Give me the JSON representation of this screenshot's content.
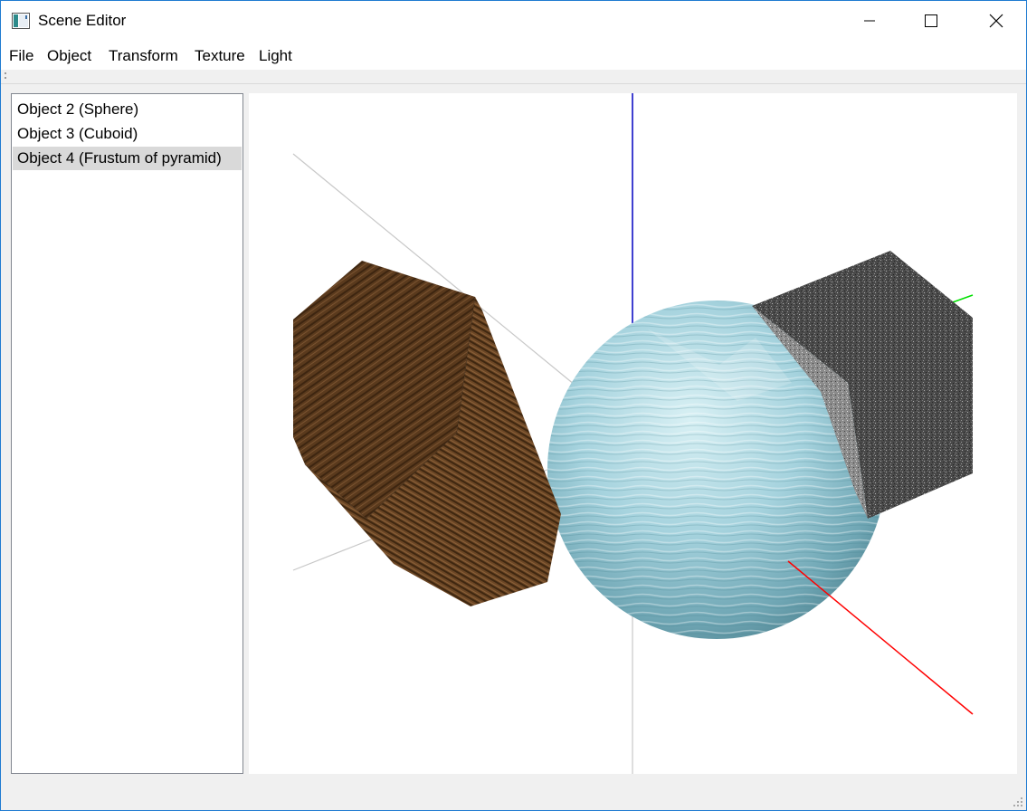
{
  "window": {
    "title": "Scene Editor",
    "app_icon": "scene-editor-app-icon",
    "controls": [
      "minimize-icon",
      "maximize-icon",
      "close-icon"
    ]
  },
  "menu": {
    "items": [
      {
        "label": "File"
      },
      {
        "label": "Object"
      },
      {
        "label": "Transform"
      },
      {
        "label": "Texture"
      },
      {
        "label": "Light"
      }
    ]
  },
  "object_list": {
    "items": [
      {
        "label": "Object 2 (Sphere)",
        "selected": false
      },
      {
        "label": "Object 3 (Cuboid)",
        "selected": false
      },
      {
        "label": "Object 4 (Frustum of pyramid)",
        "selected": true
      }
    ],
    "selected_background": "#d9d9d9"
  },
  "viewport": {
    "background": "#ffffff",
    "axis_colors": {
      "x": "#ff0000",
      "y": "#00e000",
      "z": "#0000c0",
      "secondary": "#c8c8c8"
    },
    "objects": [
      {
        "name": "Sphere",
        "texture": "water"
      },
      {
        "name": "Cuboid",
        "texture": "granite"
      },
      {
        "name": "Frustum of pyramid",
        "texture": "wood"
      }
    ]
  }
}
